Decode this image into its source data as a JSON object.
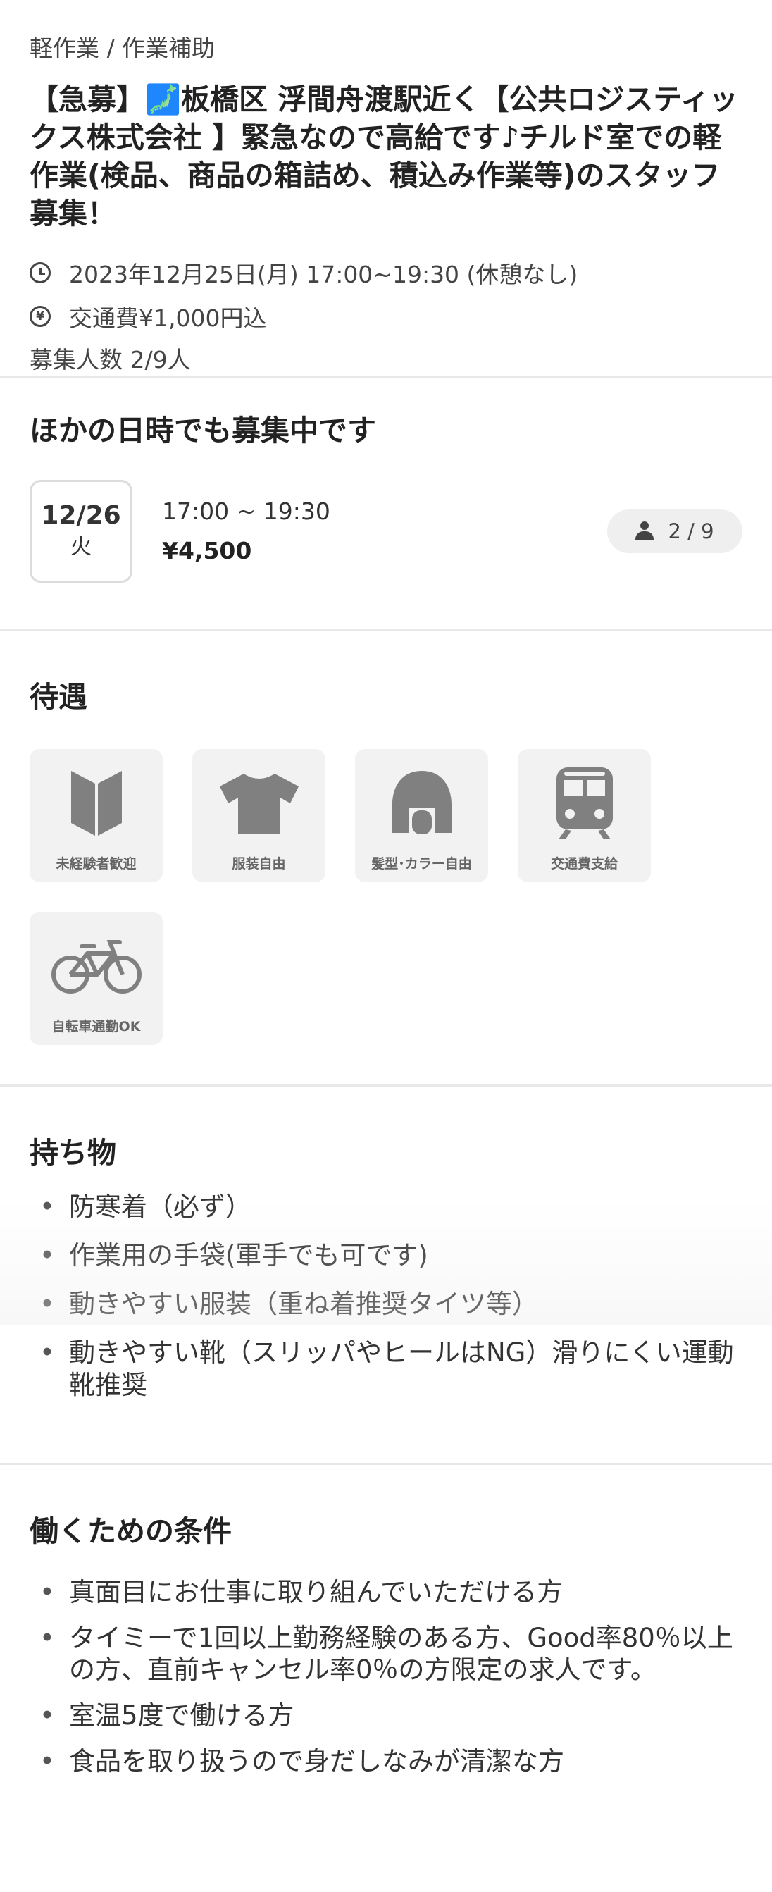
{
  "header": {
    "category": "軽作業 / 作業補助",
    "title": "【急募】🗾板橋区 浮間舟渡駅近く【公共ロジスティックス株式会社 】緊急なので高給です♪チルド室での軽作業(検品、商品の箱詰め、積込み作業等)のスタッフ募集！",
    "datetime": "2023年12月25日(月) 17:00~19:30 (休憩なし)",
    "transport": "交通費¥1,000円込",
    "headcount": "募集人数 2/9人",
    "yen_symbol": "¥",
    "icons": [
      "clock-icon",
      "yen-icon"
    ]
  },
  "other_dates": {
    "heading": "ほかの日時でも募集中です",
    "items": [
      {
        "date": "12/26",
        "weekday": "火",
        "time": "17:00 ~ 19:30",
        "pay": "¥4,500",
        "count": "2 / 9"
      }
    ]
  },
  "benefits": {
    "heading": "待遇",
    "items": [
      {
        "label": "未経験者歓迎",
        "icon": "beginner-mark-icon"
      },
      {
        "label": "服装自由",
        "icon": "tshirt-icon"
      },
      {
        "label": "髪型･カラー自由",
        "icon": "hair-icon"
      },
      {
        "label": "交通費支給",
        "icon": "train-icon"
      },
      {
        "label": "自転車通勤OK",
        "icon": "bicycle-icon"
      }
    ],
    "icon_color": "#808080"
  },
  "belongings": {
    "heading": "持ち物",
    "items": [
      "防寒着（必ず）",
      "作業用の手袋(軍手でも可です)",
      "動きやすい服装（重ね着推奨タイツ等）",
      "動きやすい靴（スリッパやヒールはNG）滑りにくい運動靴推奨"
    ]
  },
  "conditions": {
    "heading": "働くための条件",
    "items": [
      "真面目にお仕事に取り組んでいただける方",
      "タイミーで1回以上勤務経験のある方、Good率80％以上の方、直前キャンセル率0％の方限定の求人です。",
      "室温5度で働ける方",
      "食品を取り扱うので身だしなみが清潔な方"
    ]
  },
  "bullet_char": "•"
}
